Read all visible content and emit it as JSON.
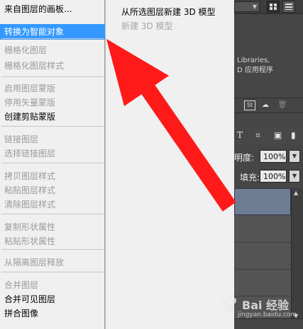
{
  "context_menu": {
    "items": [
      {
        "label": "来自图层的画板...",
        "disabled": false,
        "highlight": false
      },
      {
        "label": "转换为智能对象",
        "disabled": false,
        "highlight": true
      },
      {
        "label": "栅格化图层",
        "disabled": true,
        "highlight": false
      },
      {
        "label": "栅格化图层样式",
        "disabled": true,
        "highlight": false
      },
      {
        "label": "启用图层蒙版",
        "disabled": true,
        "highlight": false
      },
      {
        "label": "停用矢量蒙版",
        "disabled": true,
        "highlight": false
      },
      {
        "label": "创建剪贴蒙版",
        "disabled": false,
        "highlight": false
      },
      {
        "label": "链接图层",
        "disabled": true,
        "highlight": false
      },
      {
        "label": "选择链接图层",
        "disabled": true,
        "highlight": false
      },
      {
        "label": "拷贝图层样式",
        "disabled": true,
        "highlight": false
      },
      {
        "label": "粘贴图层样式",
        "disabled": true,
        "highlight": false
      },
      {
        "label": "清除图层样式",
        "disabled": true,
        "highlight": false
      },
      {
        "label": "复制形状属性",
        "disabled": true,
        "highlight": false
      },
      {
        "label": "粘贴形状属性",
        "disabled": true,
        "highlight": false
      },
      {
        "label": "从隔离图层释放",
        "disabled": true,
        "highlight": false
      },
      {
        "label": "合并图层",
        "disabled": true,
        "highlight": false
      },
      {
        "label": "合并可见图层",
        "disabled": false,
        "highlight": false
      },
      {
        "label": "拼合图像",
        "disabled": false,
        "highlight": false
      }
    ]
  },
  "submenu": {
    "items": [
      {
        "label": "从所选图层新建 3D 模型",
        "disabled": false
      },
      {
        "label": "新建 3D 模型",
        "disabled": true
      }
    ]
  },
  "libraries": {
    "line1": "Libraries,",
    "line2": "D 应用程序"
  },
  "layers_panel": {
    "opacity_label": "明度:",
    "opacity_value": "100%",
    "fill_label": "填充:",
    "fill_value": "100%"
  },
  "watermark": {
    "text": "Bai 经验",
    "sub": "jingyan.baidu.com"
  },
  "colors": {
    "highlight": "#3399ff",
    "arrow": "#ff1a1a",
    "selected_layer": "#6f7d94"
  }
}
